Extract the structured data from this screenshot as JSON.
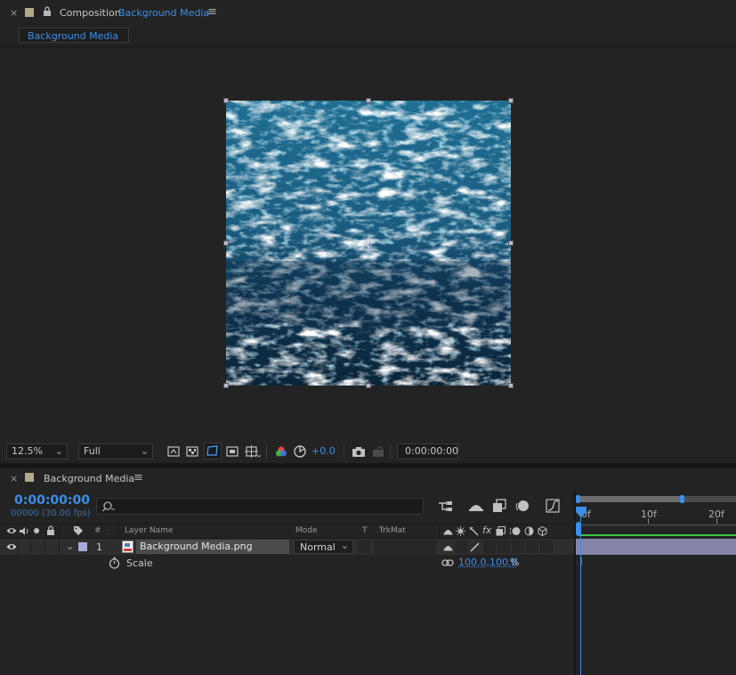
{
  "composition_panel": {
    "close_glyph": "×",
    "title_prefix": "Composition",
    "title_name": "Background Media",
    "menu_glyph": "≡",
    "subtab_label": "Background Media"
  },
  "viewer_toolbar": {
    "zoom": "12.5%",
    "resolution": "Full",
    "exposure": "+0.0",
    "timecode": "0:00:00:00"
  },
  "timeline_panel": {
    "close_glyph": "×",
    "title": "Background Media",
    "menu_glyph": "≡",
    "current_time": "0:00:00:00",
    "frame_info": "00000 (30.00 fps)",
    "search_placeholder": "",
    "columns": {
      "hash": "#",
      "layer_name": "Layer Name",
      "mode": "Mode",
      "t": "T",
      "trkmat": "TrkMat"
    },
    "layer": {
      "index": "1",
      "name": "Background Media.png",
      "mode": "Normal"
    },
    "property": {
      "name": "Scale",
      "value": "100.0,100.0",
      "unit": "%"
    },
    "ruler": {
      "ticks": [
        "0f",
        "10f",
        "20f"
      ]
    }
  },
  "colors": {
    "accent": "#3b8fe8",
    "layer_label": "#a9a9d9",
    "track_bar": "#7a7a9c",
    "work_area": "#3b8fe8"
  }
}
